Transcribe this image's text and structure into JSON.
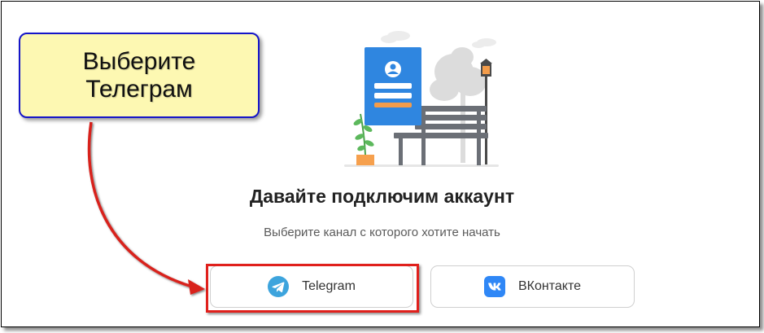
{
  "main": {
    "heading": "Давайте подключим аккаунт",
    "subheading": "Выберите канал с которого хотите начать",
    "channels": [
      {
        "label": "Telegram",
        "icon": "telegram-icon",
        "color": "#3da4dd"
      },
      {
        "label": "ВКонтакте",
        "icon": "vk-icon",
        "color": "#2f87f6"
      }
    ]
  },
  "annotation": {
    "line1": "Выберите",
    "line2": "Телеграм",
    "highlight_color": "#e0201c",
    "callout_bg": "#fdf8b2",
    "callout_border": "#1515c9"
  },
  "illustration": {
    "icon": "user-profile-card-illustration"
  }
}
